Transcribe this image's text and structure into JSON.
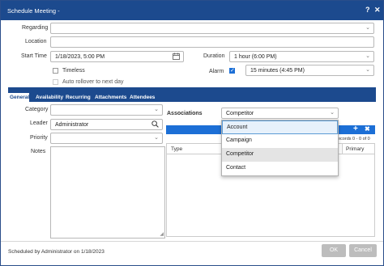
{
  "window": {
    "title": "Schedule Meeting -",
    "help_label": "?",
    "close_label": "✕"
  },
  "form": {
    "regarding_label": "Regarding",
    "regarding_value": "",
    "location_label": "Location",
    "location_value": "",
    "start_time_label": "Start Time",
    "start_time_value": "1/18/2023, 5:00 PM",
    "duration_label": "Duration",
    "duration_value": "1 hour (6:00 PM)",
    "timeless_label": "Timeless",
    "alarm_label": "Alarm",
    "alarm_checked": true,
    "alarm_value": "15 minutes (4:45 PM)",
    "auto_rollover_label": "Auto rollover to next day"
  },
  "tabs": [
    {
      "label": "General",
      "active": true
    },
    {
      "label": "Availability",
      "active": false
    },
    {
      "label": "Recurring",
      "active": false
    },
    {
      "label": "Attachments",
      "active": false
    },
    {
      "label": "Attendees",
      "active": false
    }
  ],
  "general": {
    "category_label": "Category",
    "category_value": "",
    "leader_label": "Leader",
    "leader_value": "Administrator",
    "priority_label": "Priority",
    "priority_value": "",
    "notes_label": "Notes",
    "notes_value": ""
  },
  "associations": {
    "label": "Associations",
    "selected_type": "Competitor",
    "options": [
      "Account",
      "Campaign",
      "Competitor",
      "Contact"
    ],
    "records_text": "ecords 0 - 0 of 0",
    "columns": [
      "Type",
      "Primary"
    ],
    "add_label": "+",
    "remove_label": "✖"
  },
  "footer": {
    "scheduled_by": "Scheduled by Administrator on 1/18/2023",
    "ok_label": "OK",
    "cancel_label": "Cancel"
  },
  "icons": {
    "calendar": "calendar-icon",
    "search": "search-icon",
    "chevron": "chevron-down-icon"
  },
  "colors": {
    "titlebar": "#1c4a8e",
    "accent": "#1c6fd6",
    "button_disabled": "#bdbdbd"
  }
}
